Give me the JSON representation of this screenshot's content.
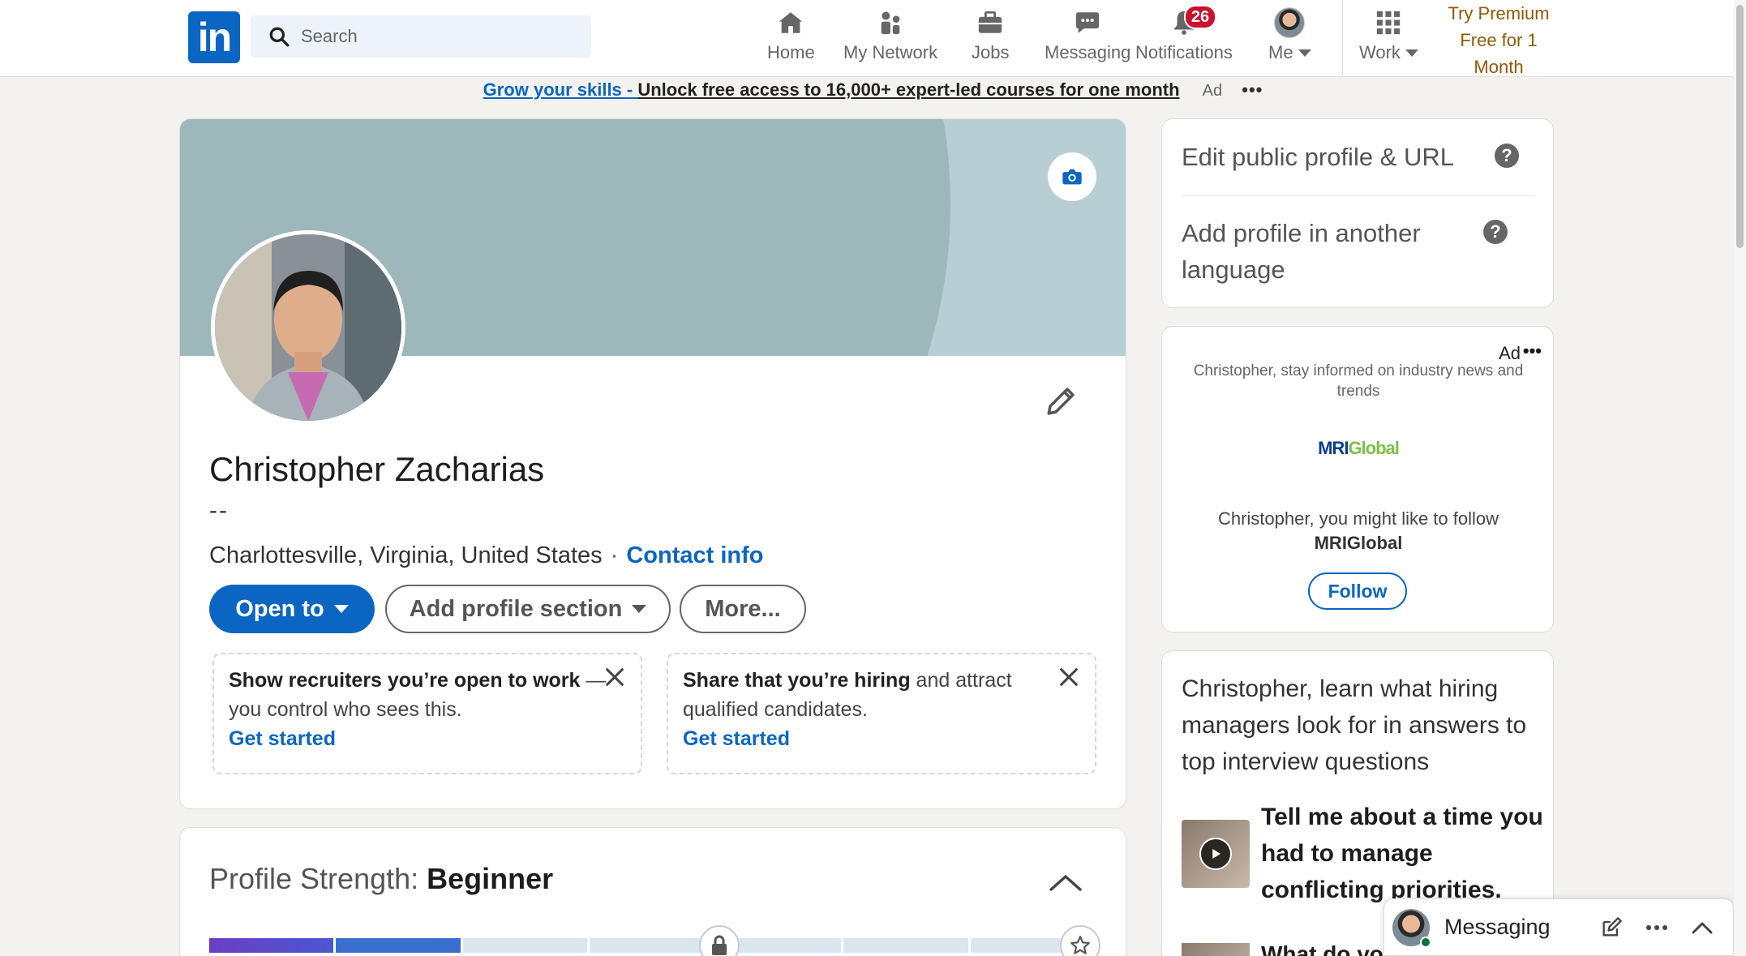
{
  "nav": {
    "logo_text": "in",
    "search_placeholder": "Search",
    "items": [
      {
        "label": "Home",
        "icon": "home-icon"
      },
      {
        "label": "My Network",
        "icon": "network-icon"
      },
      {
        "label": "Jobs",
        "icon": "briefcase-icon"
      },
      {
        "label": "Messaging",
        "icon": "chat-icon"
      },
      {
        "label": "Notifications",
        "icon": "bell-icon",
        "badge": "26"
      },
      {
        "label": "Me",
        "icon": "avatar"
      },
      {
        "label": "Work",
        "icon": "grid-icon"
      }
    ],
    "premium_lines": [
      "Try Premium",
      "Free for 1",
      "Month"
    ]
  },
  "ad_banner": {
    "link": "Grow your skills - ",
    "text": "Unlock free access to 16,000+ expert-led courses for one month",
    "ad_label": "Ad",
    "dots": "•••"
  },
  "profile": {
    "name": "Christopher Zacharias",
    "headline": "--",
    "location": "Charlottesville, Virginia, United States",
    "separator": "·",
    "contact_info": "Contact info",
    "buttons": {
      "open_to": "Open to",
      "add_section": "Add profile section",
      "more": "More..."
    },
    "promos": [
      {
        "bold": "Show recruiters you’re open to work",
        "rest": " — you control who sees this.",
        "cta": "Get started"
      },
      {
        "bold": "Share that you’re hiring",
        "rest": " and attract qualified candidates.",
        "cta": "Get started"
      }
    ]
  },
  "strength": {
    "label": "Profile Strength: ",
    "level": "Beginner",
    "filled_segments": 2,
    "total_segments": 7
  },
  "sidebar": {
    "edit_public": "Edit public profile & URL",
    "add_language": "Add profile in another language",
    "help_glyph": "?"
  },
  "ad_card": {
    "ad_label": "Ad",
    "dots": "•••",
    "text": "Christopher, stay informed on industry news and trends",
    "logo_mri": "MRI",
    "logo_global": "Global",
    "follow_line": "Christopher, you might like to follow",
    "company": "MRIGlobal",
    "follow": "Follow"
  },
  "learn_card": {
    "header": "Christopher, learn what hiring managers look for in answers to top interview questions",
    "question": "Tell me about a time you had to manage conflicting priorities.",
    "question2": "What do you"
  },
  "messaging": {
    "label": "Messaging"
  },
  "colors": {
    "brand": "#0a66c2",
    "premium": "#915907",
    "badge": "#cb112d"
  }
}
